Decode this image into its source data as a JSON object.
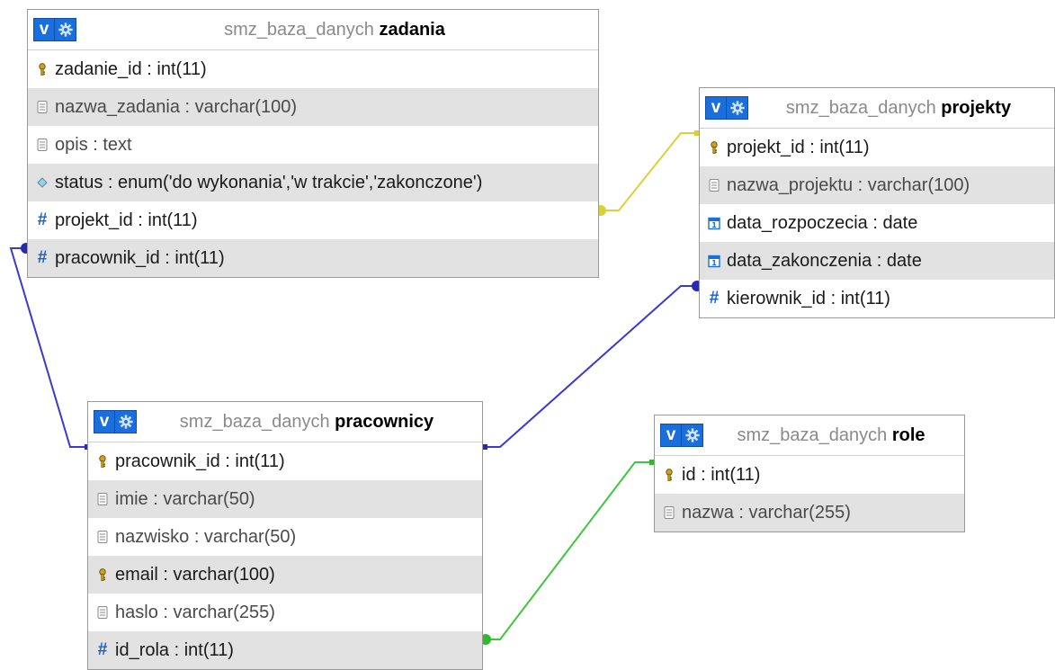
{
  "tables": [
    {
      "id": "zadania",
      "db": "smz_baza_danych",
      "name": "zadania",
      "fields": [
        {
          "text": "zadanie_id : int(11)",
          "icon": "key-icon"
        },
        {
          "text": "nazwa_zadania : varchar(100)",
          "icon": "text-field-icon"
        },
        {
          "text": "opis : text",
          "icon": "text-field-icon"
        },
        {
          "text": "status : enum('do wykonania','w trakcie','zakonczone')",
          "icon": "enum-icon"
        },
        {
          "text": "projekt_id : int(11)",
          "icon": "hash-icon"
        },
        {
          "text": "pracownik_id : int(11)",
          "icon": "hash-icon"
        }
      ]
    },
    {
      "id": "projekty",
      "db": "smz_baza_danych",
      "name": "projekty",
      "fields": [
        {
          "text": "projekt_id : int(11)",
          "icon": "key-icon"
        },
        {
          "text": "nazwa_projektu : varchar(100)",
          "icon": "text-field-icon"
        },
        {
          "text": "data_rozpoczecia : date",
          "icon": "calendar-icon"
        },
        {
          "text": "data_zakonczenia : date",
          "icon": "calendar-icon"
        },
        {
          "text": "kierownik_id : int(11)",
          "icon": "hash-icon"
        }
      ]
    },
    {
      "id": "pracownicy",
      "db": "smz_baza_danych",
      "name": "pracownicy",
      "fields": [
        {
          "text": "pracownik_id : int(11)",
          "icon": "key-icon"
        },
        {
          "text": "imie : varchar(50)",
          "icon": "text-field-icon"
        },
        {
          "text": "nazwisko : varchar(50)",
          "icon": "text-field-icon"
        },
        {
          "text": "email : varchar(100)",
          "icon": "key-icon"
        },
        {
          "text": "haslo : varchar(255)",
          "icon": "text-field-icon"
        },
        {
          "text": "id_rola : int(11)",
          "icon": "hash-icon"
        }
      ]
    },
    {
      "id": "role",
      "db": "smz_baza_danych",
      "name": "role",
      "fields": [
        {
          "text": "id : int(11)",
          "icon": "key-icon"
        },
        {
          "text": "nazwa : varchar(255)",
          "icon": "text-field-icon"
        }
      ]
    }
  ],
  "header_toggle_label": "v",
  "relations": [
    {
      "from": "zadania.projekt_id",
      "to": "projekty.projekt_id",
      "color": "#d8d23a"
    },
    {
      "from": "zadania.pracownik_id",
      "to": "pracownicy.pracownik_id",
      "color": "#3a3ad0"
    },
    {
      "from": "projekty.kierownik_id",
      "to": "pracownicy.pracownik_id",
      "color": "#3a3ad0"
    },
    {
      "from": "pracownicy.id_rola",
      "to": "role.id",
      "color": "#3cc83c"
    }
  ],
  "colors": {
    "accent": "#1a6fdc",
    "row_alt": "#e2e2e2",
    "hash": "#1a5fd0"
  }
}
